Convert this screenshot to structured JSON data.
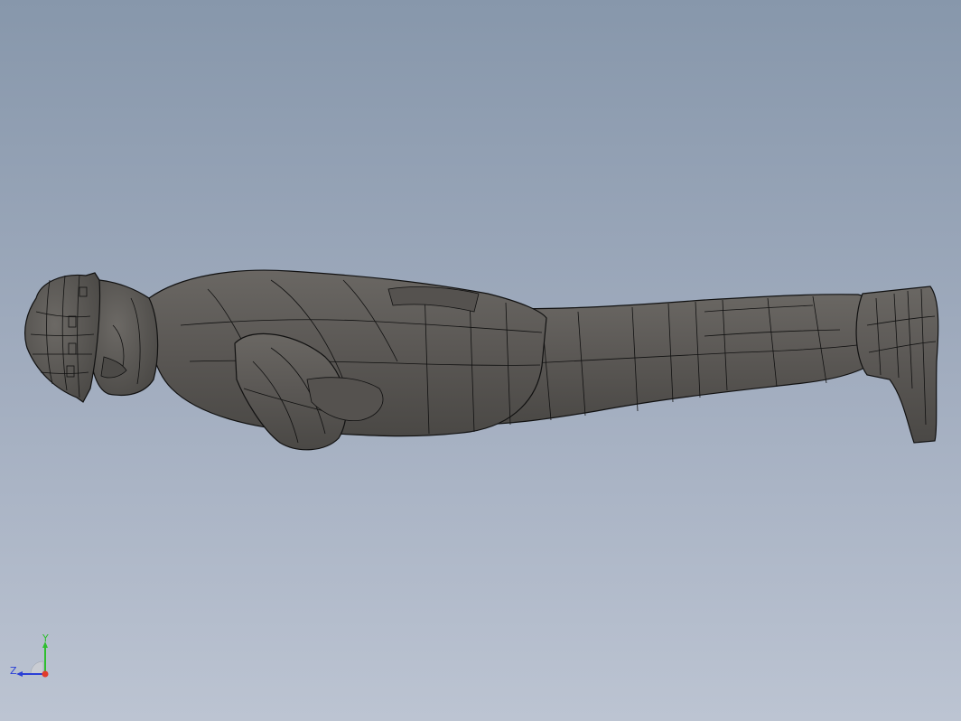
{
  "viewport": {
    "background_top": "#8797ab",
    "background_bottom": "#bcc4d2"
  },
  "model": {
    "fill_color": "#5a5754",
    "edge_color": "#111111",
    "highlight_color": "#6e6b67"
  },
  "triad": {
    "y_label": "Y",
    "z_label": "Z",
    "y_color": "#2fbf2f",
    "z_color": "#2a3fd6",
    "x_color": "#e23b2b"
  }
}
